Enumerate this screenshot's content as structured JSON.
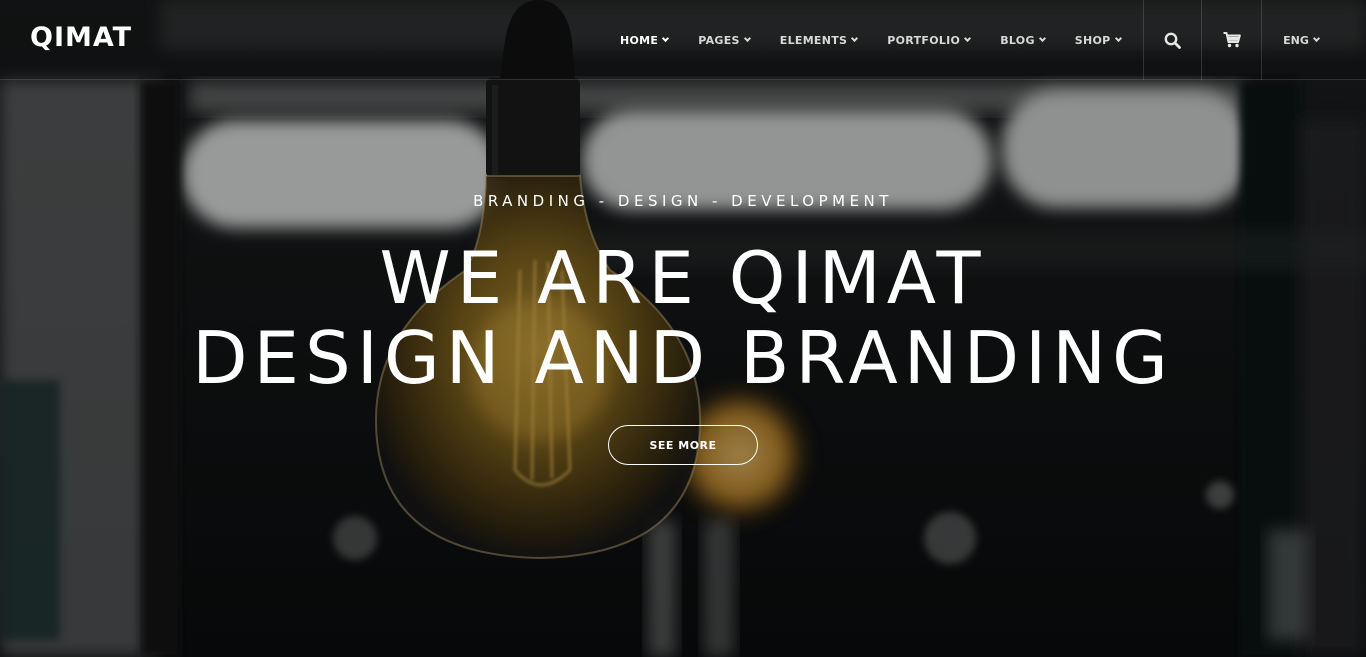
{
  "header": {
    "logo": "QIMAT",
    "nav": [
      {
        "label": "HOME",
        "active": true
      },
      {
        "label": "PAGES",
        "active": false
      },
      {
        "label": "ELEMENTS",
        "active": false
      },
      {
        "label": "PORTFOLIO",
        "active": false
      },
      {
        "label": "BLOG",
        "active": false
      },
      {
        "label": "SHOP",
        "active": false
      }
    ],
    "tools": {
      "search_icon": "search-icon",
      "cart_icon": "cart-icon",
      "language": "ENG"
    }
  },
  "hero": {
    "eyebrow": "BRANDING - DESIGN - DEVELOPMENT",
    "headline_line1": "WE ARE QIMAT",
    "headline_line2": "DESIGN AND BRANDING",
    "cta_label": "SEE MORE",
    "background": "dark photo of hanging filament light bulbs"
  },
  "colors": {
    "text": "#ffffff",
    "nav_text": "#d8d8d8",
    "bulb_glow": "#c9a13a",
    "background_dark": "#0d0f10"
  }
}
